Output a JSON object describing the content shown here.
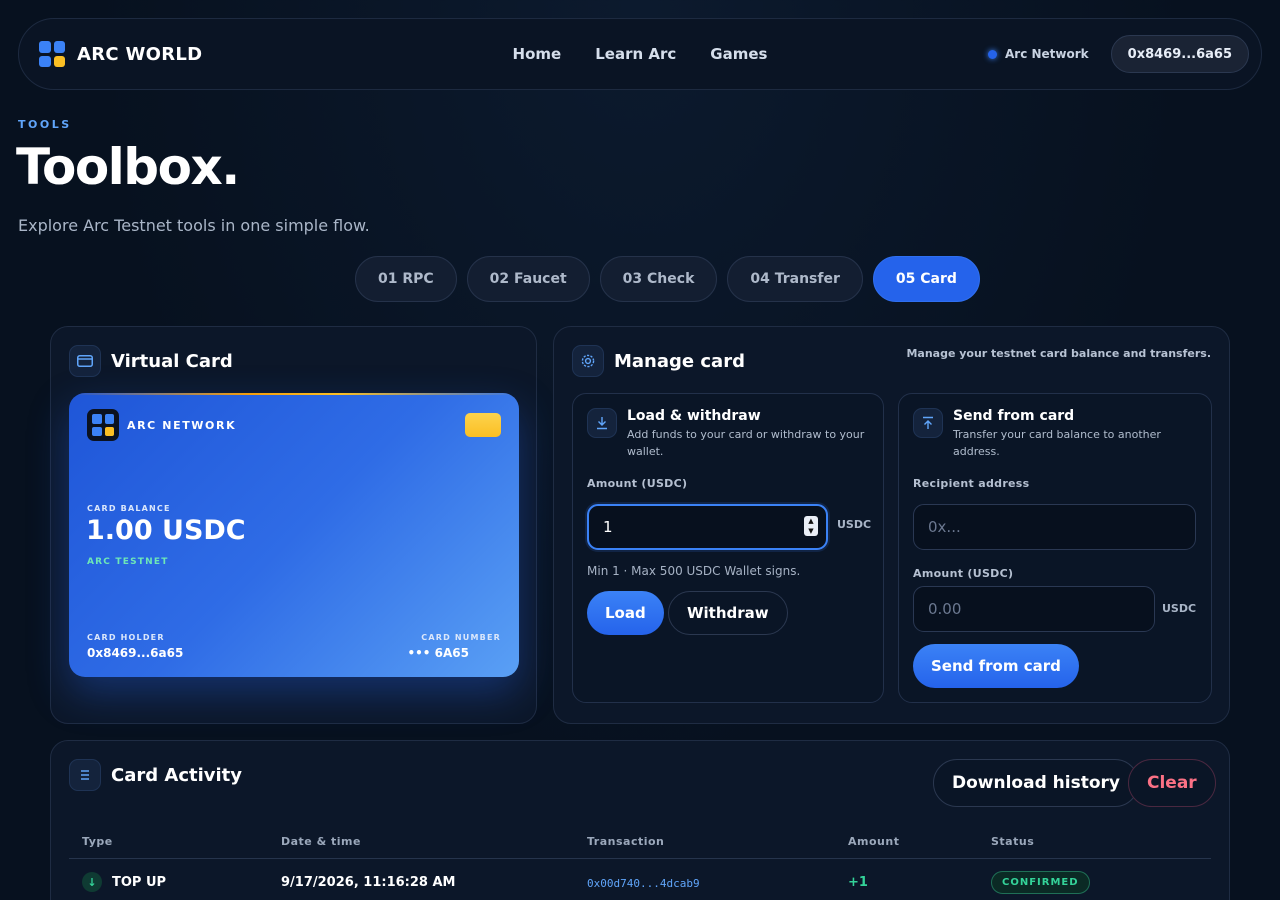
{
  "nav": {
    "brand": "ARC WORLD",
    "links": [
      "Home",
      "Learn Arc",
      "Games"
    ],
    "network": "Arc Network",
    "wallet": "0x8469...6a65"
  },
  "header": {
    "eyebrow": "TOOLS",
    "title": "Toolbox.",
    "subtitle": "Explore Arc Testnet tools in one simple flow."
  },
  "tabs": [
    {
      "label": "01 RPC",
      "active": false
    },
    {
      "label": "02 Faucet",
      "active": false
    },
    {
      "label": "03 Check",
      "active": false
    },
    {
      "label": "04 Transfer",
      "active": false
    },
    {
      "label": "05 Card",
      "active": true
    }
  ],
  "virtual_card": {
    "title": "Virtual Card",
    "network": "ARC NETWORK",
    "balance_label": "CARD BALANCE",
    "balance": "1.00 USDC",
    "chain": "ARC TESTNET",
    "holder_label": "CARD HOLDER",
    "holder": "0x8469...6a65",
    "number_label": "CARD NUMBER",
    "number": "••• 6A65"
  },
  "manage": {
    "title": "Manage card",
    "note": "Manage your testnet card balance and transfers.",
    "load": {
      "title": "Load & withdraw",
      "desc": "Add funds to your card or withdraw to your wallet.",
      "amount_label": "Amount (USDC)",
      "amount_value": "1",
      "unit": "USDC",
      "hint": "Min 1 · Max 500 USDC   Wallet signs.",
      "load_button": "Load",
      "withdraw_button": "Withdraw"
    },
    "send": {
      "title": "Send from card",
      "desc": "Transfer your card balance to another address.",
      "recipient_label": "Recipient address",
      "recipient_placeholder": "0x...",
      "amount_label": "Amount (USDC)",
      "amount_placeholder": "0.00",
      "unit": "USDC",
      "send_button": "Send from card"
    }
  },
  "activity": {
    "title": "Card Activity",
    "download_button": "Download history",
    "clear_button": "Clear",
    "columns": [
      "Type",
      "Date & time",
      "Transaction",
      "Amount",
      "Status"
    ],
    "rows": [
      {
        "type": "TOP UP",
        "date": "9/17/2026, 11:16:28 AM",
        "tx": "0x00d740...4dcab9",
        "amount": "+1",
        "status": "CONFIRMED"
      }
    ]
  },
  "colors": {
    "accent": "#2563eb",
    "success": "#34d399",
    "danger": "#fb7185",
    "background": "#07111f"
  }
}
